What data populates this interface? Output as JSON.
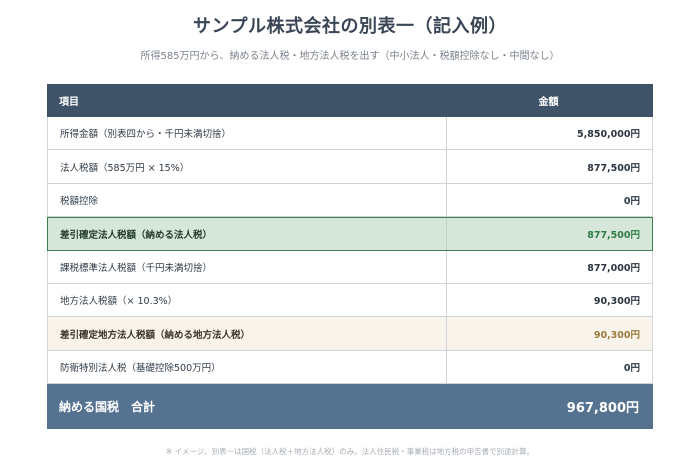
{
  "title": "サンプル株式会社の別表一（記入例）",
  "subtitle": "所得585万円から、納める法人税・地方法人税を出す（中小法人・税額控除なし・中間なし）",
  "table": {
    "header": {
      "item": "項目",
      "amount": "金額"
    },
    "rows": [
      {
        "item": "所得金額（別表四から・千円未満切捨）",
        "amount": "5,850,000円"
      },
      {
        "item": "法人税額（585万円 × 15%）",
        "amount": "877,500円"
      },
      {
        "item": "税額控除",
        "amount": "0円"
      },
      {
        "item": "差引確定法人税額（納める法人税）",
        "amount": "877,500円"
      },
      {
        "item": "課税標準法人税額（千円未満切捨）",
        "amount": "877,000円"
      },
      {
        "item": "地方法人税額（× 10.3%）",
        "amount": "90,300円"
      },
      {
        "item": "差引確定地方法人税額（納める地方法人税）",
        "amount": "90,300円"
      },
      {
        "item": "防衛特別法人税（基礎控除500万円）",
        "amount": "0円"
      }
    ],
    "total": {
      "item": "納める国税　合計",
      "amount": "967,800円"
    }
  },
  "note": "※ イメージ。別表一は国税（法人税＋地方法人税）のみ。法人住民税・事業税は地方税の申告書で別途計算。",
  "colors": {
    "header_bg": "#3f5368",
    "highlight_green": "#d6e6d8",
    "highlight_beige": "#f8f4ec",
    "total_bg": "#557391"
  }
}
